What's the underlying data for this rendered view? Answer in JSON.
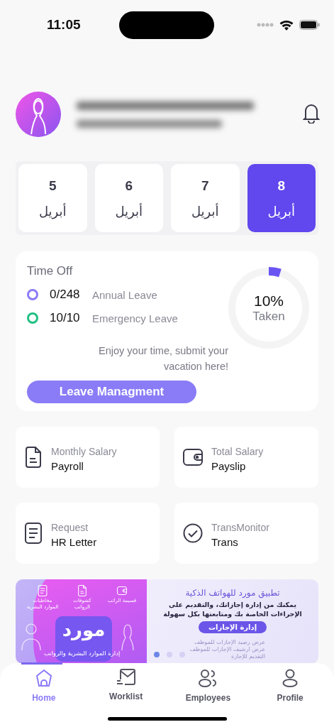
{
  "status_bar": {
    "time": "11:05"
  },
  "dates": [
    {
      "day": "8",
      "month": "أبريل",
      "selected": true
    },
    {
      "day": "7",
      "month": "أبريل",
      "selected": false
    },
    {
      "day": "6",
      "month": "أبريل",
      "selected": false
    },
    {
      "day": "5",
      "month": "أبريل",
      "selected": false
    }
  ],
  "time_off": {
    "title": "Time Off",
    "leaves": [
      {
        "count": "0/248",
        "label": "Annual Leave",
        "color": "#8b7cf6"
      },
      {
        "count": "10/10",
        "label": "Emergency Leave",
        "color": "#22c084"
      }
    ],
    "percent": "10%",
    "caption": "Taken",
    "message": "Enjoy your time, submit your vacation here!",
    "button": "Leave Managment"
  },
  "tiles": [
    {
      "kind": "wallet",
      "caption": "Total Salary",
      "label": "Payslip"
    },
    {
      "kind": "document",
      "caption": "Monthly Salary",
      "label": "Payroll"
    },
    {
      "kind": "check",
      "caption": "TransMonitor",
      "label": "Trans"
    },
    {
      "kind": "list",
      "caption": "Request",
      "label": "HR Letter"
    }
  ],
  "banner": {
    "features": [
      {
        "kind": "wallet",
        "label": "قسيمة الراتب"
      },
      {
        "kind": "document",
        "label": "كشوفات الرواتب"
      },
      {
        "kind": "list",
        "label": "مخاطبات الموارد البشرية"
      }
    ],
    "logo": "مورد",
    "logo_caption": "إدارة الموارد البشرية والرواتب",
    "title": "تطبيق مورد للهواتف الذكية",
    "body": "يمكنك من إدارة إجازاتك، والتقديم على الإجراءات الخاصة بك ومتابعتها بكل سهولة",
    "button": "إدارة الإجازات",
    "notes": [
      "عرض رصيد الإجازات للموظف",
      "عرض ارشيف الإجازات للموظف",
      "التقديم للإجازة"
    ],
    "dots": [
      {
        "selected": true
      },
      {
        "selected": false
      },
      {
        "selected": false
      }
    ]
  },
  "nav": [
    {
      "kind": "person",
      "label": "Profile",
      "selected": false
    },
    {
      "kind": "people",
      "label": "Employees",
      "selected": false
    },
    {
      "kind": "mail",
      "label": "Worklist",
      "selected": false
    },
    {
      "kind": "home",
      "label": "Home",
      "selected": true
    }
  ]
}
